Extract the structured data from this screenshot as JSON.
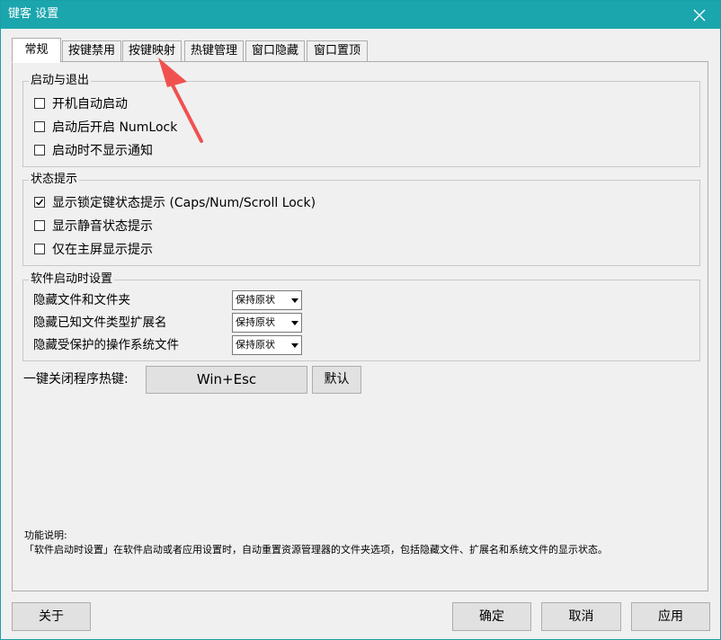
{
  "window": {
    "title": "键客 设置",
    "titlebar_color": "#1ba5ad"
  },
  "tabs": [
    {
      "label": "常规",
      "active": true
    },
    {
      "label": "按键禁用",
      "active": false
    },
    {
      "label": "按键映射",
      "active": false
    },
    {
      "label": "热键管理",
      "active": false
    },
    {
      "label": "窗口隐藏",
      "active": false
    },
    {
      "label": "窗口置顶",
      "active": false
    }
  ],
  "startup_group": {
    "title": "启动与退出",
    "options": [
      {
        "label": "开机自动启动",
        "checked": false
      },
      {
        "label": "启动后开启 NumLock",
        "checked": false
      },
      {
        "label": "启动时不显示通知",
        "checked": false
      }
    ]
  },
  "status_group": {
    "title": "状态提示",
    "options": [
      {
        "label": "显示锁定键状态提示 (Caps/Num/Scroll Lock)",
        "checked": true
      },
      {
        "label": "显示静音状态提示",
        "checked": false
      },
      {
        "label": "仅在主屏显示提示",
        "checked": false
      }
    ]
  },
  "software_group": {
    "title": "软件启动时设置",
    "rows": [
      {
        "label": "隐藏文件和文件夹",
        "value": "保持原状"
      },
      {
        "label": "隐藏已知文件类型扩展名",
        "value": "保持原状"
      },
      {
        "label": "隐藏受保护的操作系统文件",
        "value": "保持原状"
      }
    ]
  },
  "hotkey": {
    "label": "一键关闭程序热键:",
    "value": "Win+Esc",
    "default_button": "默认"
  },
  "notes": {
    "heading": "功能说明:",
    "text": "「软件启动时设置」在软件启动或者应用设置时，自动重置资源管理器的文件夹选项，包括隐藏文件、扩展名和系统文件的显示状态。"
  },
  "footer": {
    "about": "关于",
    "ok": "确定",
    "cancel": "取消",
    "apply": "应用"
  },
  "annotation": {
    "arrow_color": "#f0514f",
    "points_to": "tab-key-mapping"
  }
}
